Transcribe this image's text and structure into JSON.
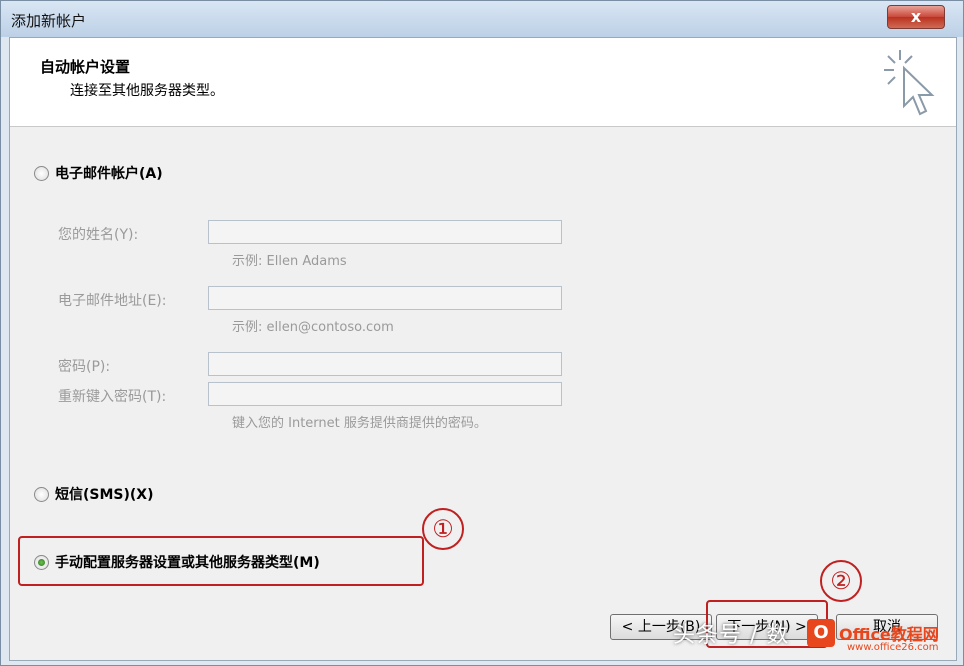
{
  "window": {
    "title": "添加新帐户",
    "close_label": "x"
  },
  "header": {
    "title": "自动帐户设置",
    "subtitle": "连接至其他服务器类型。"
  },
  "options": {
    "email_account": "电子邮件帐户(A)",
    "sms": "短信(SMS)(X)",
    "manual": "手动配置服务器设置或其他服务器类型(M)"
  },
  "form": {
    "name_label": "您的姓名(Y):",
    "name_value": "",
    "name_hint": "示例: Ellen Adams",
    "email_label": "电子邮件地址(E):",
    "email_value": "",
    "email_hint": "示例: ellen@contoso.com",
    "password_label": "密码(P):",
    "password_value": "",
    "retype_label": "重新键入密码(T):",
    "retype_value": "",
    "password_hint": "键入您的 Internet 服务提供商提供的密码。"
  },
  "buttons": {
    "back": "< 上一步(B)",
    "next": "下一步(N) >",
    "cancel": "取消"
  },
  "annotations": {
    "callout_1": "①",
    "callout_2": "②"
  },
  "watermark": {
    "text": "头条号 / 数",
    "logo_letter": "O",
    "logo_name": "Office教程网",
    "logo_url": "www.office26.com"
  },
  "colors": {
    "highlight": "#c02020",
    "radio_selected": "#2b7a18"
  }
}
